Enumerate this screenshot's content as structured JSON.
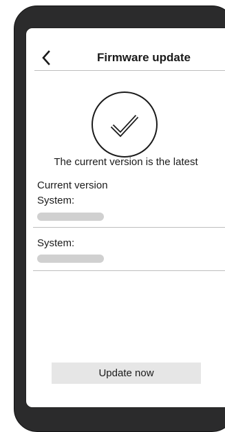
{
  "header": {
    "back_icon": "chevron-left-icon",
    "title": "Firmware update"
  },
  "status": {
    "icon": "checkmark-circle-icon",
    "message": "The current version is the latest"
  },
  "current_version": {
    "section_title": "Current version",
    "system_label": "System:"
  },
  "new_version": {
    "system_label": "System:"
  },
  "actions": {
    "update_label": "Update now"
  },
  "colors": {
    "device_frame": "#2b2b2c",
    "screen_bg": "#ffffff",
    "divider": "#bdbdbd",
    "placeholder_bar": "#d0d0d0",
    "button_bg": "#e6e6e6",
    "text": "#1a1a1a"
  }
}
